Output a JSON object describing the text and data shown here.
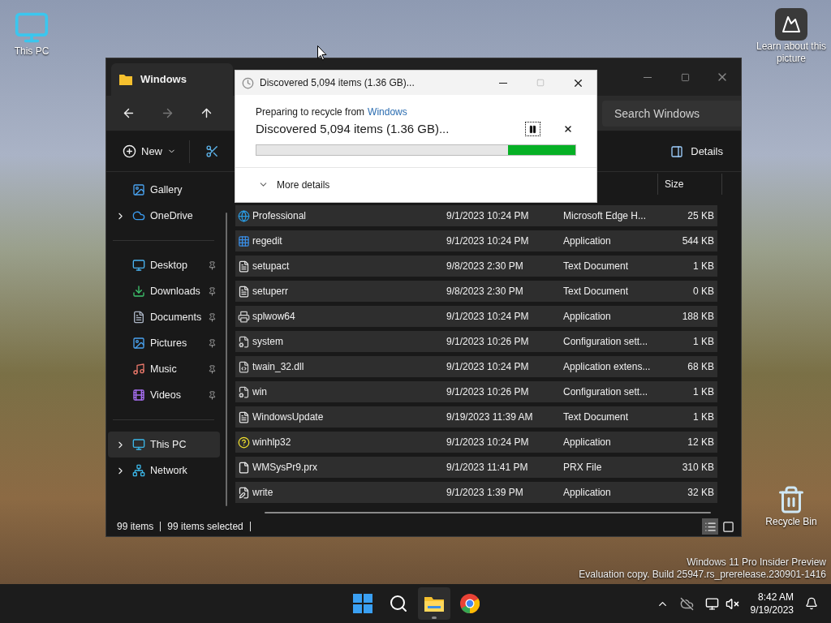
{
  "desktop": {
    "icons": [
      {
        "kind": "pc",
        "label": "This PC"
      },
      {
        "kind": "picture",
        "label": "Learn about this picture"
      },
      {
        "kind": "bin",
        "label": "Recycle Bin"
      }
    ],
    "watermark": [
      "Windows 11 Pro Insider Preview",
      "Evaluation copy. Build 25947.rs_prerelease.230901-1416"
    ]
  },
  "explorer": {
    "title": "Windows",
    "search": {
      "placeholder": "Search Windows"
    },
    "commands": {
      "new": "New",
      "details": "Details"
    },
    "sidebar": {
      "groups": [
        {
          "items": [
            {
              "kind": "plain",
              "label": "Gallery",
              "selected": false
            },
            {
              "kind": "expandable",
              "label": "OneDrive",
              "selected": false
            }
          ]
        },
        {
          "items": [
            {
              "kind": "pinned",
              "label": "Desktop",
              "selected": false
            },
            {
              "kind": "pinned",
              "label": "Downloads",
              "selected": false
            },
            {
              "kind": "pinned",
              "label": "Documents",
              "selected": false
            },
            {
              "kind": "pinned",
              "label": "Pictures",
              "selected": false
            },
            {
              "kind": "pinned",
              "label": "Music",
              "selected": false
            },
            {
              "kind": "pinned",
              "label": "Videos",
              "selected": false
            }
          ]
        },
        {
          "items": [
            {
              "kind": "expandable",
              "label": "This PC",
              "selected": true
            },
            {
              "kind": "expandable",
              "label": "Network",
              "selected": false
            }
          ]
        }
      ]
    },
    "columns": [
      {
        "label": "Size"
      }
    ],
    "rows": [
      {
        "kind": "edge",
        "name": "Professional",
        "date": "9/1/2023 10:24 PM",
        "type": "Microsoft Edge H...",
        "size": "25 KB",
        "selected": true
      },
      {
        "kind": "regedit",
        "name": "regedit",
        "date": "9/1/2023 10:24 PM",
        "type": "Application",
        "size": "544 KB",
        "selected": true
      },
      {
        "kind": "text",
        "name": "setupact",
        "date": "9/8/2023 2:30 PM",
        "type": "Text Document",
        "size": "1 KB",
        "selected": true
      },
      {
        "kind": "text",
        "name": "setuperr",
        "date": "9/8/2023 2:30 PM",
        "type": "Text Document",
        "size": "0 KB",
        "selected": true
      },
      {
        "kind": "printer",
        "name": "splwow64",
        "date": "9/1/2023 10:24 PM",
        "type": "Application",
        "size": "188 KB",
        "selected": true
      },
      {
        "kind": "config",
        "name": "system",
        "date": "9/1/2023 10:26 PM",
        "type": "Configuration sett...",
        "size": "1 KB",
        "selected": true
      },
      {
        "kind": "dll",
        "name": "twain_32.dll",
        "date": "9/1/2023 10:24 PM",
        "type": "Application extens...",
        "size": "68 KB",
        "selected": true
      },
      {
        "kind": "config",
        "name": "win",
        "date": "9/1/2023 10:26 PM",
        "type": "Configuration sett...",
        "size": "1 KB",
        "selected": true
      },
      {
        "kind": "text",
        "name": "WindowsUpdate",
        "date": "9/19/2023 11:39 AM",
        "type": "Text Document",
        "size": "1 KB",
        "selected": true
      },
      {
        "kind": "help",
        "name": "winhlp32",
        "date": "9/1/2023 10:24 PM",
        "type": "Application",
        "size": "12 KB",
        "selected": true
      },
      {
        "kind": "blank",
        "name": "WMSysPr9.prx",
        "date": "9/1/2023 11:41 PM",
        "type": "PRX File",
        "size": "310 KB",
        "selected": true
      },
      {
        "kind": "write",
        "name": "write",
        "date": "9/1/2023 1:39 PM",
        "type": "Application",
        "size": "32 KB",
        "selected": true
      }
    ],
    "status": [
      "99 items",
      "99 items selected"
    ],
    "views": [
      {
        "kind": "details",
        "selected": true
      },
      {
        "kind": "tiles",
        "selected": false
      }
    ]
  },
  "dialog": {
    "title": "Discovered 5,094 items (1.36 GB)...",
    "source_prefix": "Preparing to recycle from",
    "source_link": "Windows",
    "heading": "Discovered 5,094 items (1.36 GB)...",
    "progress": {
      "level": 0.21
    },
    "more_details": "More details"
  },
  "taskbar": {
    "apps": [
      {
        "kind": "start",
        "active": false
      },
      {
        "kind": "search",
        "active": false
      },
      {
        "kind": "explorer",
        "active": true
      },
      {
        "kind": "chrome",
        "active": false
      }
    ],
    "time": "8:42 AM",
    "date": "9/19/2023"
  }
}
